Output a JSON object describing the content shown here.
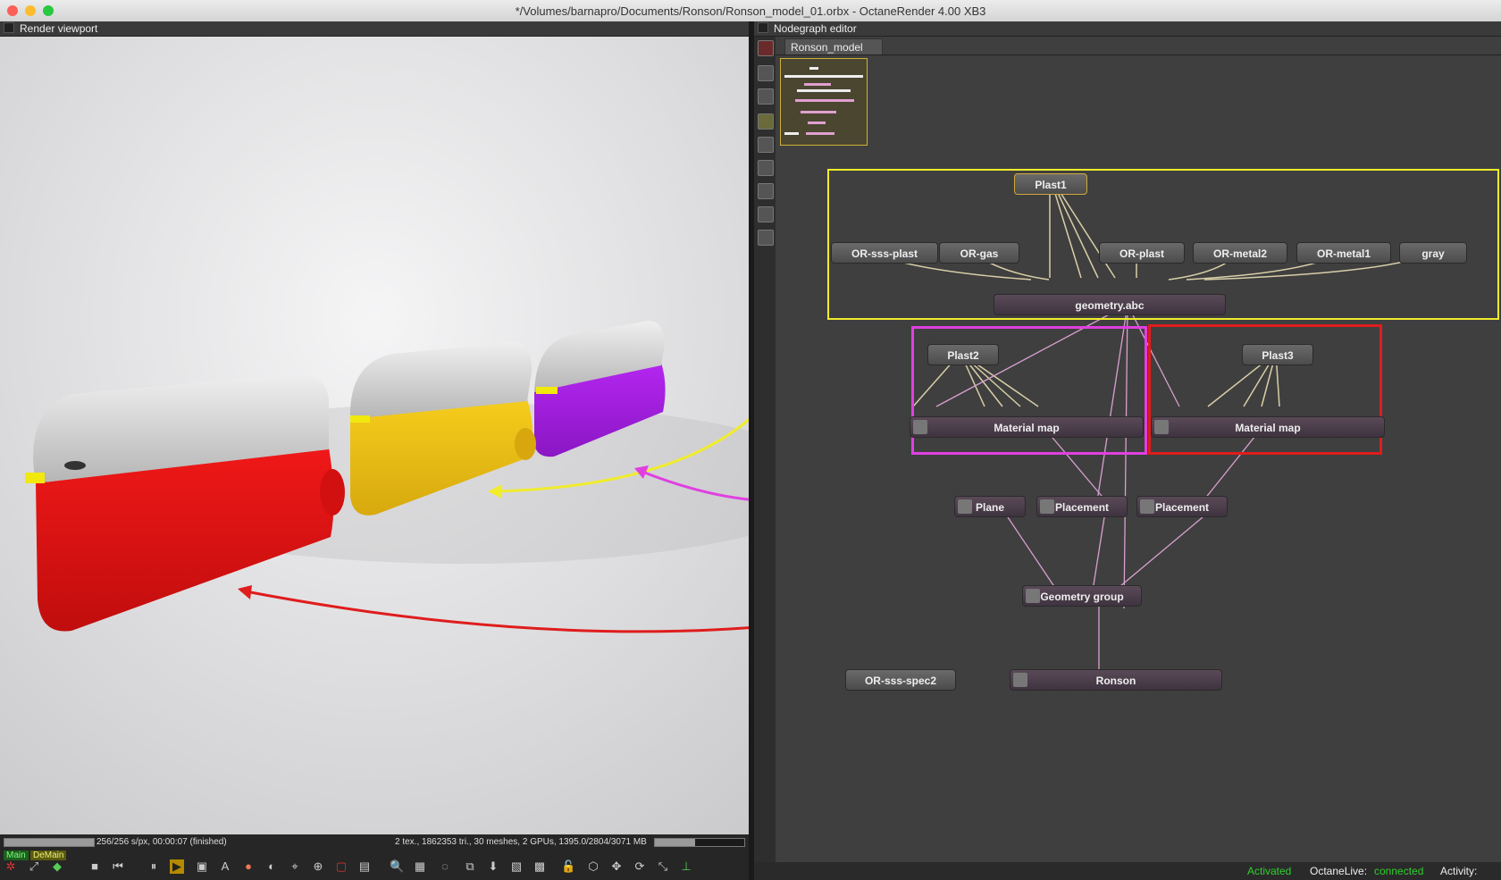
{
  "window": {
    "title": "*/Volumes/barnapro/Documents/Ronson/Ronson_model_01.orbx - OctaneRender 4.00 XB3"
  },
  "render_panel": {
    "header": "Render viewport",
    "stats_left": "256/256 s/px, 00:00:07 (finished)",
    "stats_right": "2 tex., 1862353 tri., 30 meshes, 2 GPUs, 1395.0/2804/3071 MB",
    "tag_main": "Main",
    "tag_demain": "DeMain",
    "progress": 1.0
  },
  "node_panel": {
    "header": "Nodegraph editor",
    "tab": "Ronson_model",
    "nodes": {
      "plast1": "Plast1",
      "or_sss_plast": "OR-sss-plast",
      "or_gas": "OR-gas",
      "or_plast": "OR-plast",
      "or_metal2": "OR-metal2",
      "or_metal1": "OR-metal1",
      "gray": "gray",
      "geometry_abc": "geometry.abc",
      "plast2": "Plast2",
      "plast3": "Plast3",
      "material_map": "Material map",
      "plane": "Plane",
      "placement": "Placement",
      "geometry_group": "Geometry group",
      "or_sss_spec2": "OR-sss-spec2",
      "ronson": "Ronson"
    }
  },
  "statusbar": {
    "activated": "Activated",
    "octanelive_label": "OctaneLive:",
    "octanelive_value": "connected",
    "activity_label": "Activity:"
  },
  "colors": {
    "yellow_frame": "#f0ec2c",
    "magenta_frame": "#e040e0",
    "red_frame": "#e01c1c",
    "status_green": "#2fd02f",
    "wire": "#d9cfa8",
    "wire_pink": "#d9a0d0"
  }
}
